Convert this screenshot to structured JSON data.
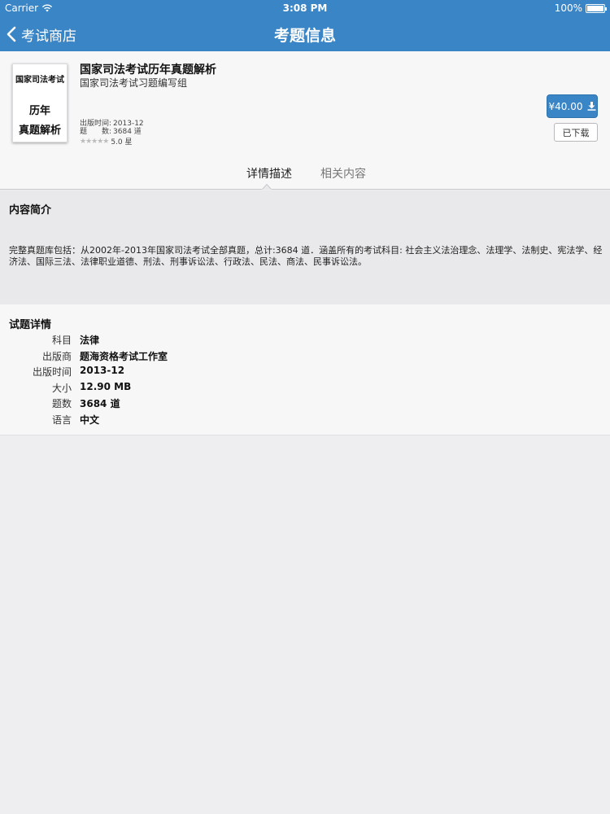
{
  "status_bar": {
    "carrier": "Carrier",
    "time": "3:08 PM",
    "battery": "100%"
  },
  "nav": {
    "back_label": "考试商店",
    "title": "考题信息"
  },
  "book": {
    "cover_line1": "国家司法考试",
    "cover_line2": "历年",
    "cover_line3": "真题解析",
    "title": "国家司法考试历年真题解析",
    "author": "国家司法考试习题编写组",
    "pub_label": "出版时间:",
    "pub_date": "2013-12",
    "count_label": "题　　数:",
    "count": "3684 道",
    "stars": "★★★★★",
    "rating": "5.0 星",
    "price": "¥40.00",
    "downloaded_label": "已下载"
  },
  "tabs": [
    {
      "label": "详情描述",
      "active": true
    },
    {
      "label": "相关内容",
      "active": false
    }
  ],
  "intro": {
    "heading": "内容简介",
    "text": "完整真题库包括：从2002年-2013年国家司法考试全部真题，总计:3684 道．涵盖所有的考试科目: 社会主义法治理念、法理学、法制史、宪法学、经济法、国际三法、法律职业道德、刑法、刑事诉讼法、行政法、民法、商法、民事诉讼法。"
  },
  "details": {
    "heading": "试题详情",
    "rows": [
      {
        "label": "科目",
        "value": "法律"
      },
      {
        "label": "出版商",
        "value": "题海资格考试工作室"
      },
      {
        "label": "出版时间",
        "value": "2013-12"
      },
      {
        "label": "大小",
        "value": "12.90 MB"
      },
      {
        "label": "题数",
        "value": "3684 道"
      },
      {
        "label": "语言",
        "value": "中文"
      }
    ]
  },
  "colors": {
    "accent": "#3a85c6",
    "background": "#eeeef0"
  },
  "icons": {
    "back": "chevron-left-icon",
    "wifi": "wifi-icon",
    "battery": "battery-icon",
    "download": "download-icon"
  }
}
